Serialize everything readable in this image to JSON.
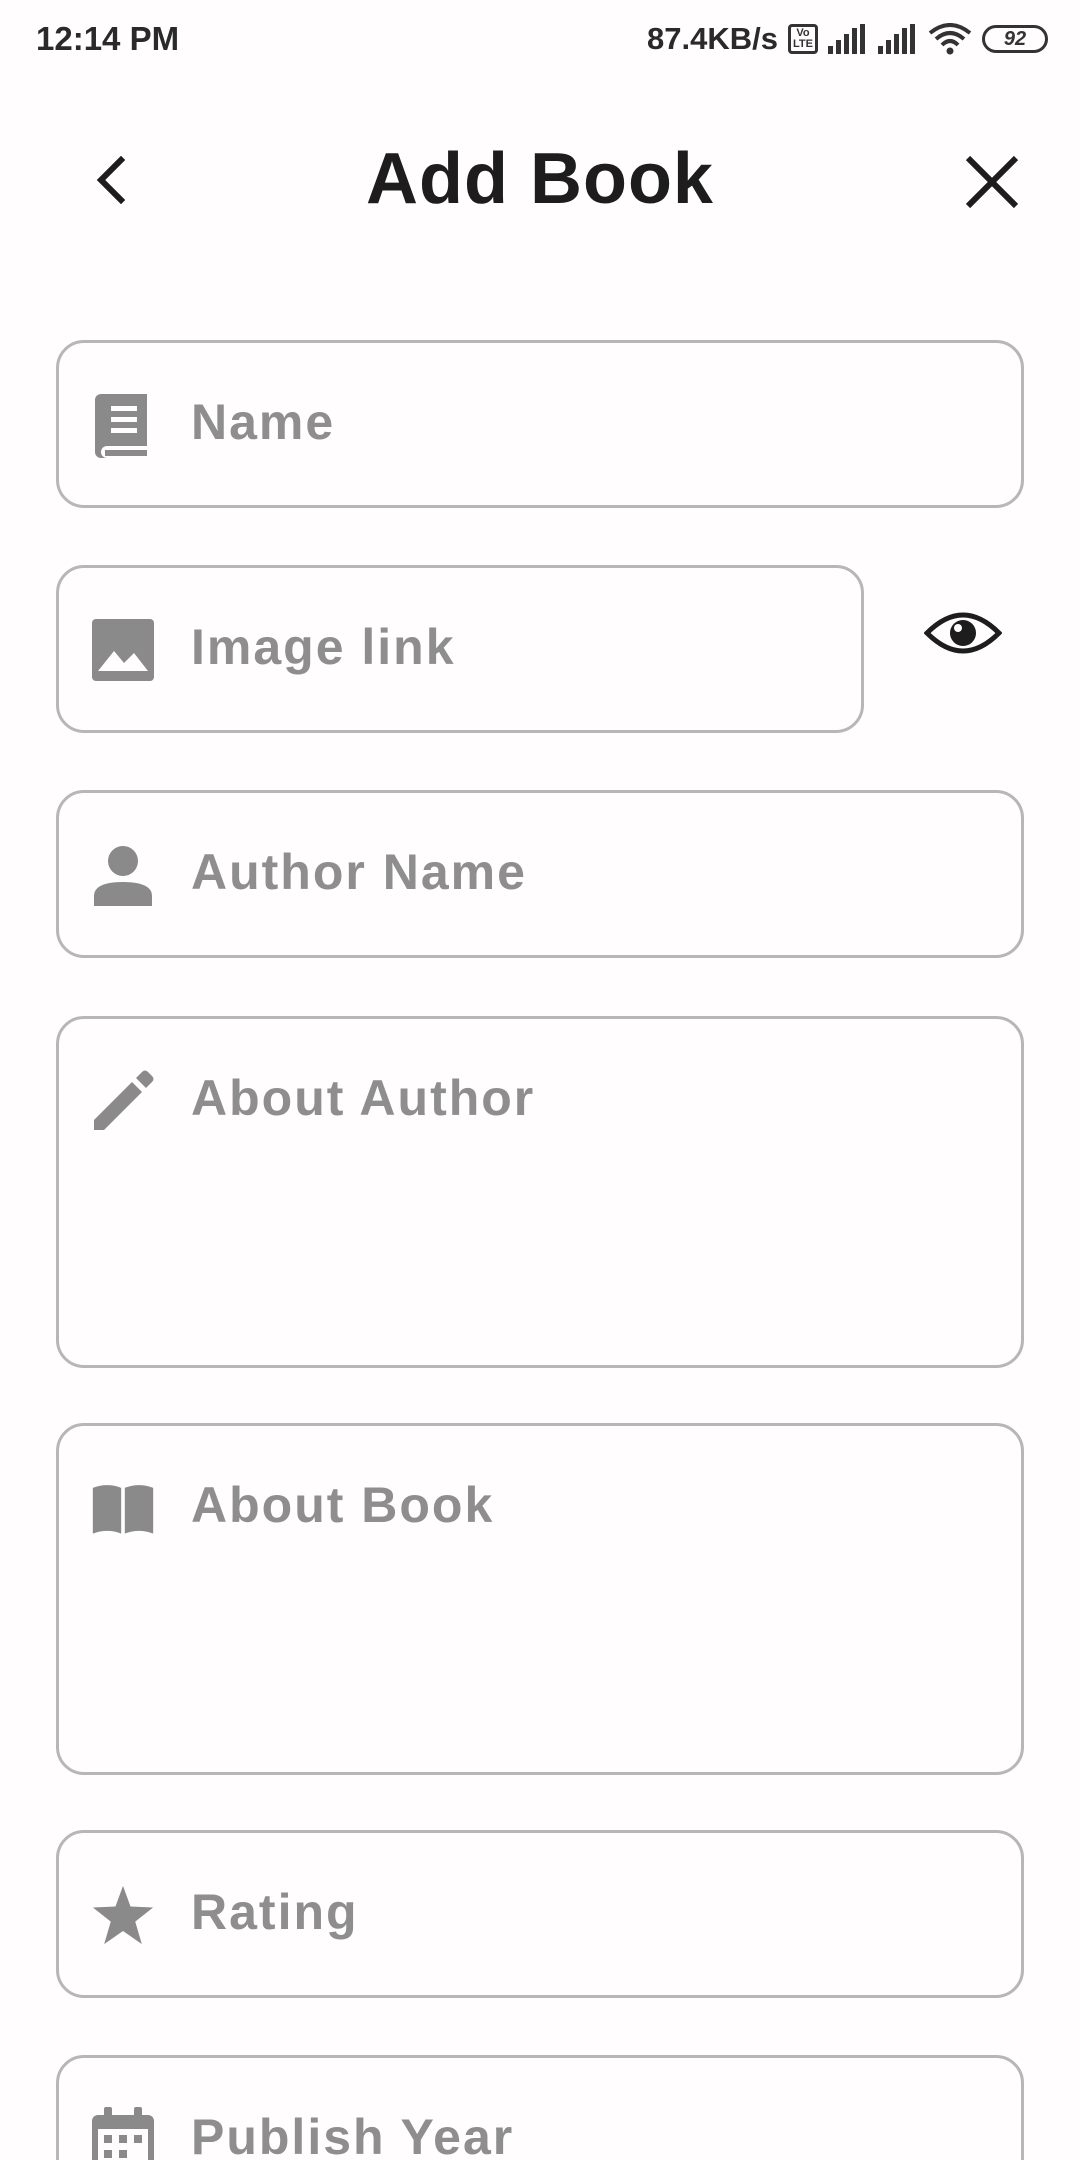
{
  "status_bar": {
    "time": "12:14 PM",
    "speed": "87.4KB/s",
    "volte": "Vo LTE",
    "battery": "92"
  },
  "header": {
    "title": "Add Book",
    "back_icon": "chevron-left-icon",
    "close_icon": "close-icon"
  },
  "form": {
    "name": {
      "placeholder": "Name",
      "icon": "book-icon"
    },
    "image_link": {
      "placeholder": "Image link",
      "icon": "image-icon",
      "preview_icon": "eye-icon"
    },
    "author_name": {
      "placeholder": "Author Name",
      "icon": "person-icon"
    },
    "about_author": {
      "placeholder": "About Author",
      "icon": "pencil-icon"
    },
    "about_book": {
      "placeholder": "About Book",
      "icon": "open-book-icon"
    },
    "rating": {
      "placeholder": "Rating",
      "icon": "star-icon"
    },
    "publish_year": {
      "placeholder": "Publish Year",
      "icon": "calendar-icon"
    }
  },
  "colors": {
    "background": "#fffdfd",
    "border": "#b7b7b7",
    "placeholder": "#8e8e8e",
    "icon": "#8a8a8a",
    "title": "#1d1d1d"
  }
}
